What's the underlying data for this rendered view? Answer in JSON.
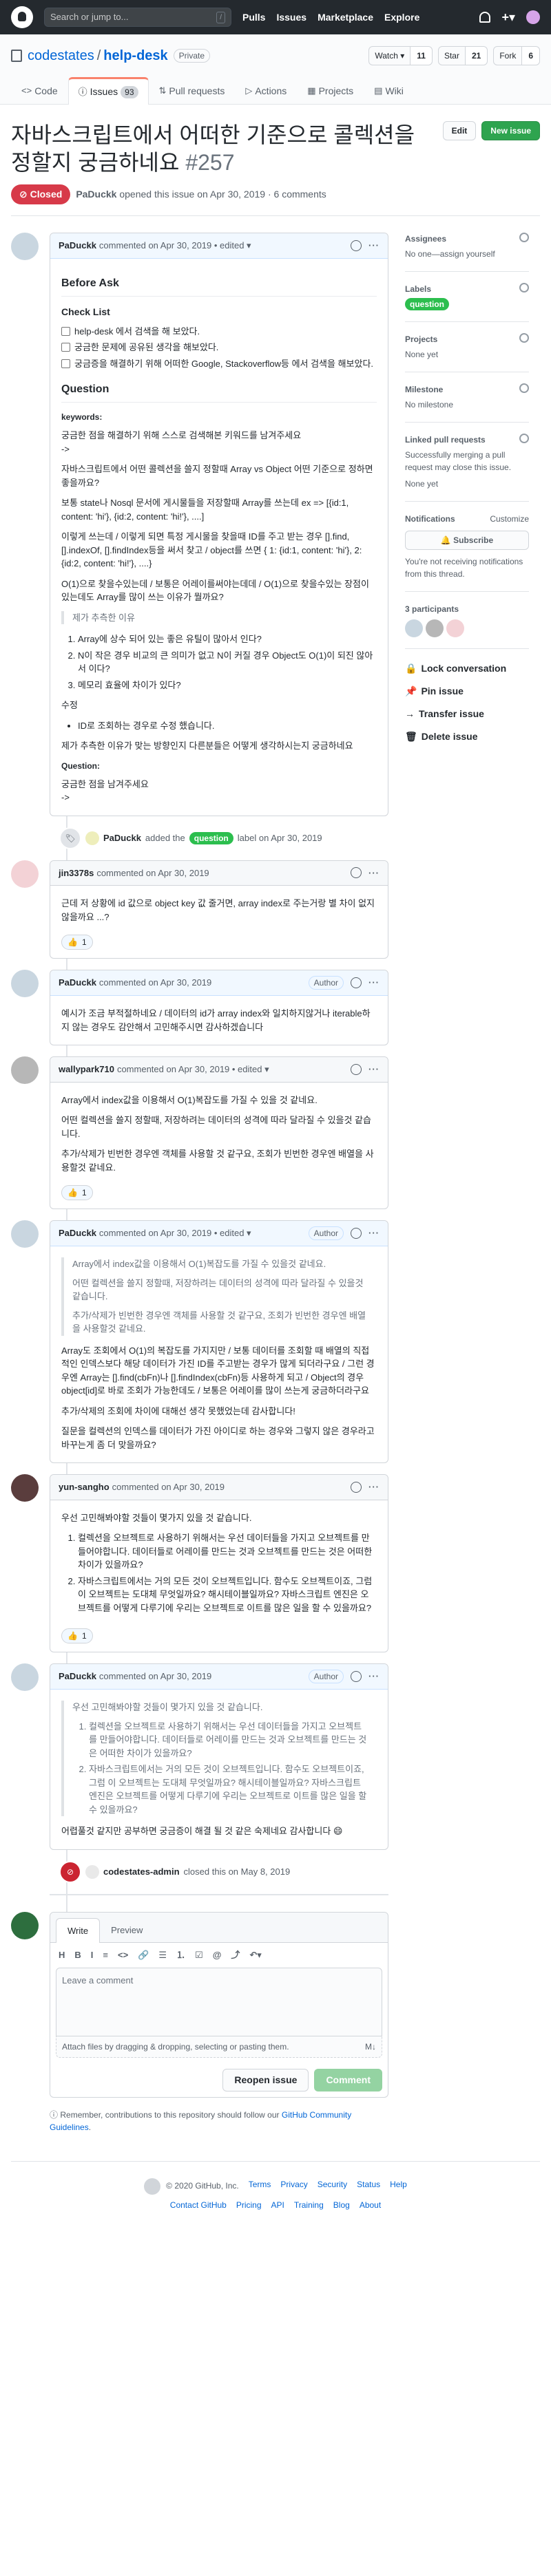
{
  "header": {
    "search_placeholder": "Search or jump to...",
    "search_key": "/",
    "nav": [
      "Pulls",
      "Issues",
      "Marketplace",
      "Explore"
    ]
  },
  "repo": {
    "owner": "codestates",
    "separator": "/",
    "name": "help-desk",
    "visibility": "Private",
    "watch_label": "Watch ▾",
    "watch_count": "11",
    "star_label": "Star",
    "star_count": "21",
    "fork_label": "Fork",
    "fork_count": "6",
    "tabs": [
      {
        "icon": "<>",
        "label": "Code"
      },
      {
        "icon": "ⓘ",
        "label": "Issues",
        "count": "93"
      },
      {
        "icon": "⇅",
        "label": "Pull requests"
      },
      {
        "icon": "▷",
        "label": "Actions"
      },
      {
        "icon": "▦",
        "label": "Projects"
      },
      {
        "icon": "▤",
        "label": "Wiki"
      }
    ]
  },
  "issue": {
    "title": "자바스크립트에서 어떠한 기준으로 콜렉션을 정할지 궁금하네요",
    "number": "#257",
    "edit_label": "Edit",
    "new_issue_label": "New issue",
    "state": "Closed",
    "author": "PaDuckk",
    "meta": "opened this issue on Apr 30, 2019 · 6 comments"
  },
  "comments": [
    {
      "author": "PaDuckk",
      "meta": "commented on Apr 30, 2019 • edited ▾",
      "h2_before": "Before Ask",
      "checklist_title": "Check List",
      "tasks": [
        "help-desk 에서 검색을 해 보았다.",
        "궁금한 문제에 공유된 생각을 해보았다.",
        "궁금증을 해결하기 위해 어떠한 Google, Stackoverflow등 에서 검색을 해보았다."
      ],
      "h2_question": "Question",
      "keywords_title": "keywords:",
      "p1": "궁금한 점을 해결하기 위해 스스로 검색해본 키워드를 남겨주세요",
      "p1b": "->",
      "p2": "자바스크립트에서 어떤 콜렉션을 쓸지 정할때 Array vs Object 어떤 기준으로 정하면 좋을까요?",
      "p3": "보통 state나 Nosql 문서에 게시물들을 저장할때 Array를 쓰는데 ex => [{id:1, content: 'hi'}, {id:2, content: 'hi!'}, ....]",
      "p4": "이렇게 쓰는데 / 이렇게 되면 특정 게시물을 찾을때 ID를 주고 받는 경우 [].find, [].indexOf, [].findIndex등을 써서 찾고 / object를 쓰면 { 1: {id:1, content: 'hi'}, 2: {id:2, content: 'hi!'}, ....}",
      "p5": "O(1)으로 찾을수있는데 / 보통은 어레이를써야는데데 / O(1)으로 찾을수있는 장점이 있는데도 Array를 많이 쓰는 이유가 뭘까요?",
      "quote_title": "제가 추측한 이유",
      "reasons": [
        "Array에 상수 되어 있는 좋은 유틸이 많아서 인다?",
        "N이 작은 경우 비교의 큰 의미가 없고 N이 커질 경우 Object도 O(1)이 되진 않아서 이다?",
        "메모리 효율에 차이가 있다?"
      ],
      "fix_title": "수정",
      "fix_item": "ID로 조회하는 경우로 수정 했습니다.",
      "p6": "제가 추측한 이유가 맞는 방향인지 다른분들은 어떻게 생각하시는지 궁금하네요",
      "q_title": "Question:",
      "q1": "궁금한 점을 남겨주세요",
      "q2": "->"
    },
    {
      "author": "jin3378s",
      "meta": "commented on Apr 30, 2019",
      "body": "근데 저 상황에 id 값으로 object key 값 줄거면, array index로 주는거랑 별 차이 없지 않을까요 ...?",
      "reaction": "1"
    },
    {
      "author": "PaDuckk",
      "meta": "commented on Apr 30, 2019",
      "badge": "Author",
      "body": "예시가 조금 부적절하네요 / 데이터의 id가 array index와 일치하지않거나 iterable하지 않는 경우도 감안해서 고민해주시면 감사하겠습니다"
    },
    {
      "author": "wallypark710",
      "meta": "commented on Apr 30, 2019 • edited ▾",
      "p1": "Array에서 index값을 이용해서 O(1)복잡도를 가질 수 있을 것 같네요.",
      "p2": "어떤 컬렉션을 쓸지 정할때, 저장하려는 데이터의 성격에 따라 달라질 수 있을것 같습니다.",
      "p3": "추가/삭제가 빈번한 경우엔 객체를 사용할 것 같구요, 조회가 빈번한 경우엔 배열을 사용할것 같네요.",
      "reaction": "1"
    },
    {
      "author": "PaDuckk",
      "meta": "commented on Apr 30, 2019 • edited ▾",
      "badge": "Author",
      "quote1": "Array에서 index값을 이용해서 O(1)복잡도를 가질 수 있을것 같네요.",
      "quote2": "어떤 컬렉션을 쓸지 정할때, 저장하려는 데이터의 성격에 따라 달라질 수 있을것 같습니다.",
      "quote3": "추가/삭제가 빈번한 경우엔 객체를 사용할 것 같구요, 조회가 빈번한 경우엔 배열을 사용할것 같네요.",
      "p1": "Array도 조회에서 O(1)의 복잡도를 가지지만 / 보통 데이터를 조회할 때 배열의 직접적인 인덱스보다 해당 데이터가 가진 ID를 주고받는 경우가 많게 되더라구요 / 그런 경우엔 Array는 [].find(cbFn)나 [].findIndex(cbFn)등 사용하게 되고 / Object의 경우 object[id]로 바로 조회가 가능한데도 / 보통은 어레이를 많이 쓰는게 궁금하더라구요",
      "p2": "추가/삭제의 조회에 차이에 대해선 생각 못했었는데 감사합니다!",
      "p3": "질문을 컬렉션의 인덱스를 데이터가 가진 아이디로 하는 경우와 그렇지 않은 경우라고 바꾸는게 좀 더 맞을까요?"
    },
    {
      "author": "yun-sangho",
      "meta": "commented on Apr 30, 2019",
      "intro": "우선 고민해봐야할 것들이 몇가지 있을 것 같습니다.",
      "items": [
        "컬렉션을 오브젝트로 사용하기 위해서는 우선 데이터들을 가지고 오브젝트를 만들어야합니다. 데이터들로 어레이를 만드는 것과 오브젝트를 만드는 것은 어떠한 차이가 있을까요?",
        "자바스크립트에서는 거의 모든 것이 오브젝트입니다. 함수도 오브젝트이죠, 그럼 이 오브젝트는 도대체 무엇일까요? 해시테이블일까요? 자바스크립트 엔진은 오브젝트를 어떻게 다루기에 우리는 오브젝트로 이트를 많은 일을 할 수 있을까요?"
      ],
      "reaction": "1"
    },
    {
      "author": "PaDuckk",
      "meta": "commented on Apr 30, 2019",
      "badge": "Author",
      "quote_intro": "우선 고민해봐야할 것들이 몇가지 있을 것 같습니다.",
      "quote_items": [
        "컬렉션을 오브젝트로 사용하기 위해서는 우선 데이터들을 가지고 오브젝트를 만들어야합니다. 데이터들로 어레이를 만드는 것과 오브젝트를 만드는 것은 어떠한 차이가 있을까요?",
        "자바스크립트에서는 거의 모든 것이 오브젝트입니다. 함수도 오브젝트이죠, 그럼 이 오브젝트는 도대체 무엇일까요? 해시테이블일까요? 자바스크립트 엔진은 오브젝트를 어떻게 다루기에 우리는 오브젝트로 이트를 많은 일을 할 수 있을까요?"
      ],
      "body": "어렵풀것 같지만 공부하면 궁금증이 해결 될 것 같은 숙제네요 감사합니다 😄"
    }
  ],
  "events": {
    "label_actor": "PaDuckk",
    "label_text": "added the",
    "label_name": "question",
    "label_time": "label on Apr 30, 2019",
    "close_actor": "codestates-admin",
    "close_text": "closed this on May 8, 2019"
  },
  "editor": {
    "tab_write": "Write",
    "tab_preview": "Preview",
    "toolbar": [
      "H",
      "B",
      "I",
      "≡",
      "<>",
      "🔗",
      "☰",
      "⒈",
      "☑",
      "@",
      "⤴",
      "↶▾"
    ],
    "placeholder": "Leave a comment",
    "attach": "Attach files by dragging & dropping, selecting or pasting them.",
    "md": "M↓",
    "reopen_label": "Reopen issue",
    "comment_label": "Comment",
    "remember_prefix": "Remember, contributions to this repository should follow our",
    "remember_link": "GitHub Community Guidelines",
    "remember_suffix": "."
  },
  "sidebar": {
    "assignees_title": "Assignees",
    "assignees_value": "No one—assign yourself",
    "labels_title": "Labels",
    "labels_value": "question",
    "projects_title": "Projects",
    "projects_value": "None yet",
    "milestone_title": "Milestone",
    "milestone_value": "No milestone",
    "linked_title": "Linked pull requests",
    "linked_desc": "Successfully merging a pull request may close this issue.",
    "linked_value": "None yet",
    "notif_title": "Notifications",
    "notif_customize": "Customize",
    "subscribe_label": "Subscribe",
    "notif_desc": "You're not receiving notifications from this thread.",
    "participants_title": "3 participants",
    "actions": [
      "Lock conversation",
      "Pin issue",
      "Transfer issue",
      "Delete issue"
    ]
  },
  "footer": {
    "copyright": "© 2020 GitHub, Inc.",
    "row1": [
      "Terms",
      "Privacy",
      "Security",
      "Status",
      "Help"
    ],
    "row2": [
      "Contact GitHub",
      "Pricing",
      "API",
      "Training",
      "Blog",
      "About"
    ]
  },
  "colors": {
    "closed": "#d73a49",
    "label_question": "#2cbe4e",
    "link": "#0366d6"
  }
}
